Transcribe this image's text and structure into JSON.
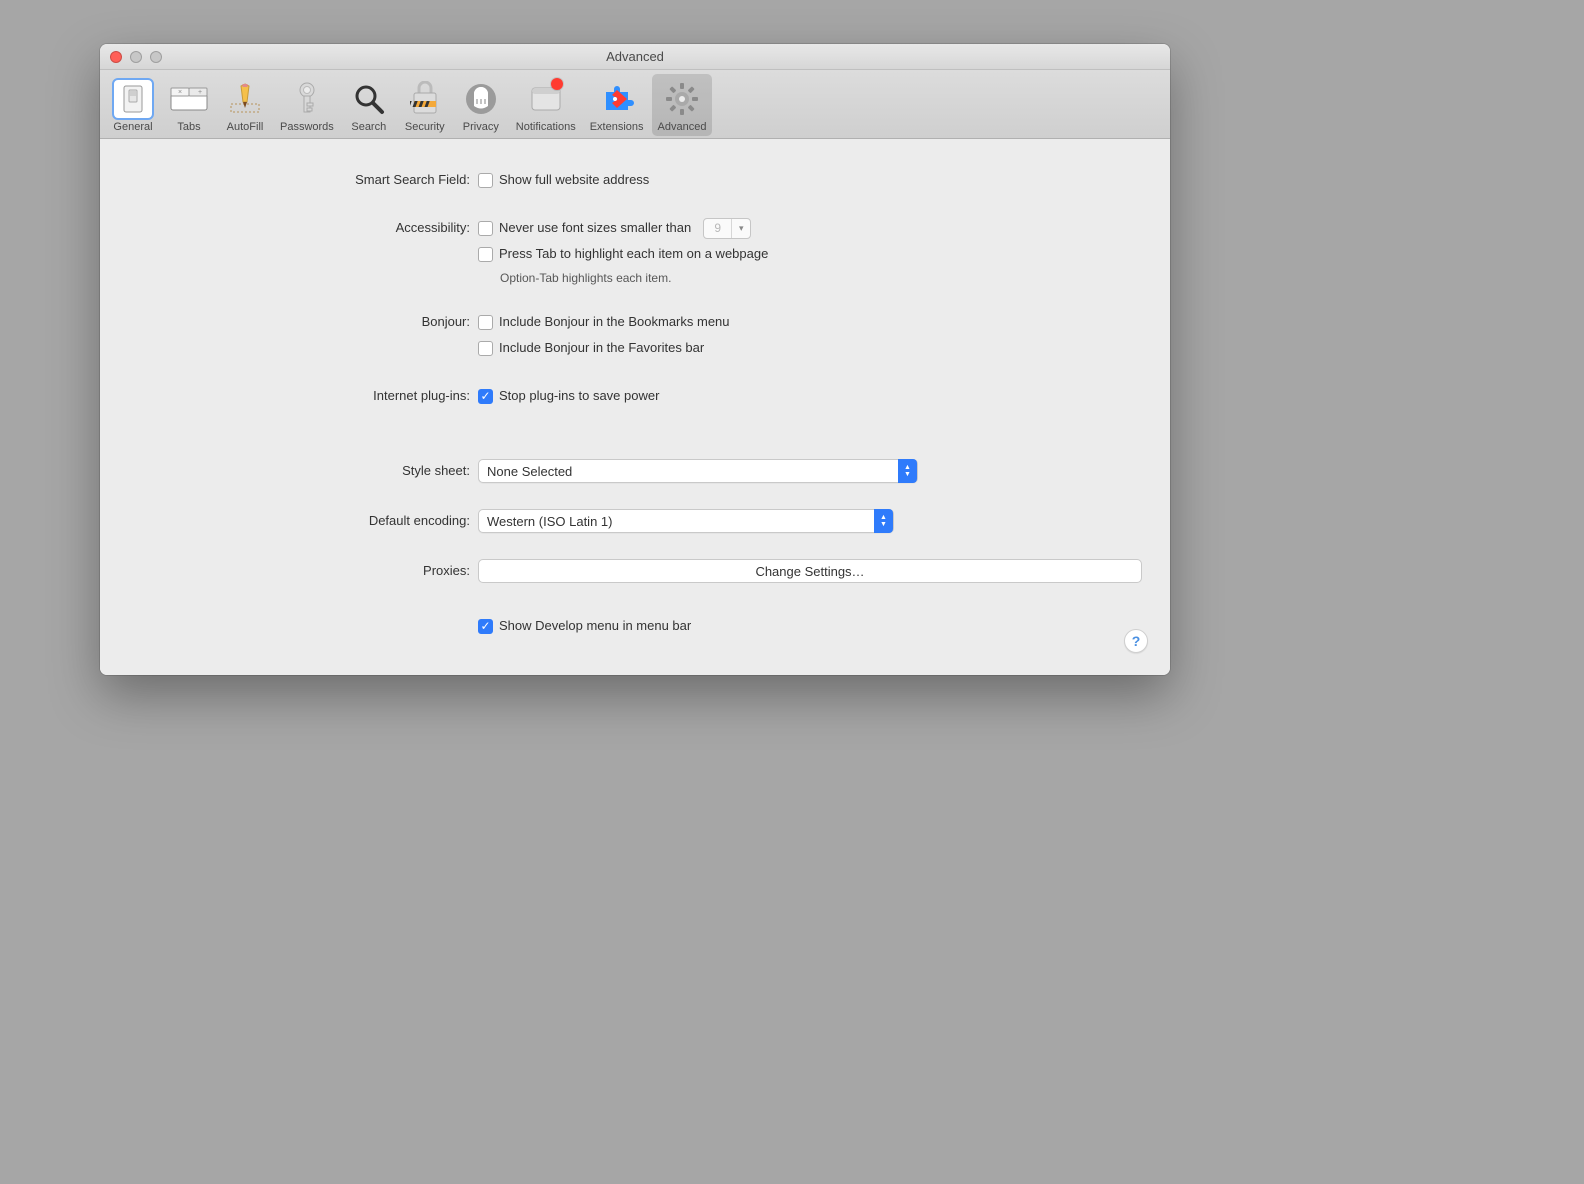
{
  "window": {
    "title": "Advanced"
  },
  "toolbar": {
    "items": [
      {
        "label": "General"
      },
      {
        "label": "Tabs"
      },
      {
        "label": "AutoFill"
      },
      {
        "label": "Passwords"
      },
      {
        "label": "Search"
      },
      {
        "label": "Security"
      },
      {
        "label": "Privacy"
      },
      {
        "label": "Notifications"
      },
      {
        "label": "Extensions"
      },
      {
        "label": "Advanced"
      }
    ]
  },
  "fields": {
    "smart_search": {
      "label": "Smart Search Field:",
      "show_full_address": "Show full website address"
    },
    "accessibility": {
      "label": "Accessibility:",
      "never_font": "Never use font sizes smaller than",
      "font_value": "9",
      "press_tab": "Press Tab to highlight each item on a webpage",
      "option_tab_note": "Option-Tab highlights each item."
    },
    "bonjour": {
      "label": "Bonjour:",
      "bookmarks": "Include Bonjour in the Bookmarks menu",
      "favorites": "Include Bonjour in the Favorites bar"
    },
    "plugins": {
      "label": "Internet plug-ins:",
      "stop_plugins": "Stop plug-ins to save power"
    },
    "stylesheet": {
      "label": "Style sheet:",
      "value": "None Selected"
    },
    "encoding": {
      "label": "Default encoding:",
      "value": "Western (ISO Latin 1)"
    },
    "proxies": {
      "label": "Proxies:",
      "button": "Change Settings…"
    },
    "develop": {
      "label": "Show Develop menu in menu bar"
    }
  },
  "help": "?"
}
